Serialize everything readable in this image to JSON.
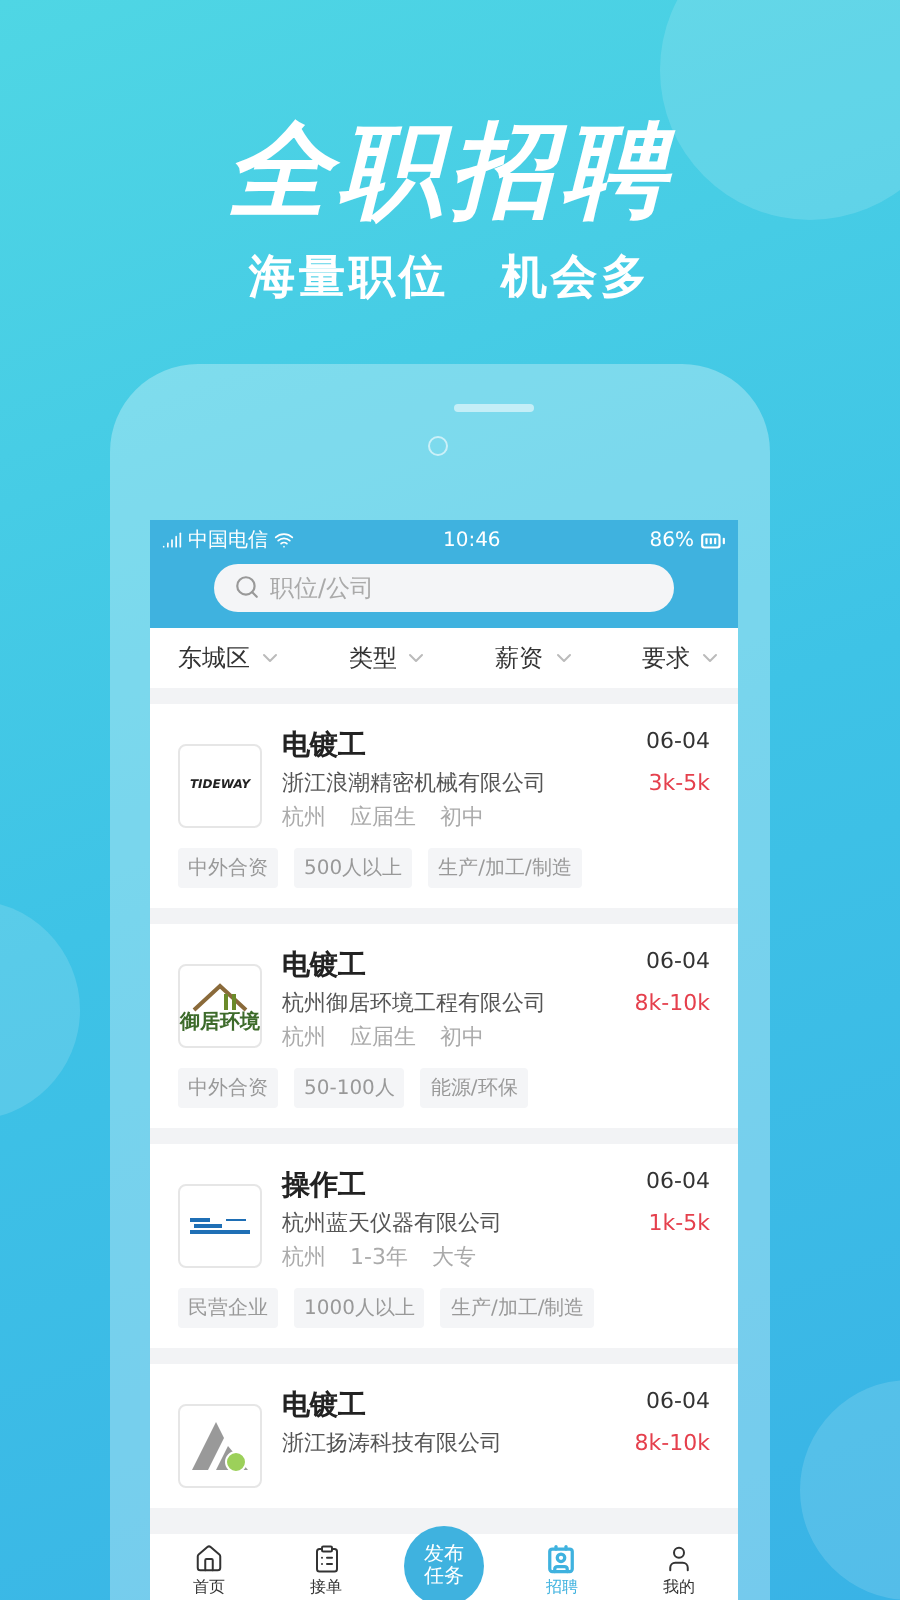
{
  "hero": {
    "title": "全职招聘",
    "subtitle": [
      "海量职位",
      "机会多"
    ]
  },
  "status_bar": {
    "carrier": "中国电信",
    "time": "10:46",
    "battery": "86%"
  },
  "search": {
    "placeholder": "职位/公司"
  },
  "filters": [
    {
      "label": "东城区"
    },
    {
      "label": "类型"
    },
    {
      "label": "薪资"
    },
    {
      "label": "要求"
    }
  ],
  "jobs": [
    {
      "title": "电镀工",
      "company": "浙江浪潮精密机械有限公司",
      "date": "06-04",
      "salary": "3k-5k",
      "meta": [
        "杭州",
        "应届生",
        "初中"
      ],
      "tags": [
        "中外合资",
        "500人以上",
        "生产/加工/制造"
      ],
      "logo": {
        "kind": "wordmark",
        "text": "TIDEWAY"
      }
    },
    {
      "title": "电镀工",
      "company": "杭州御居环境工程有限公司",
      "date": "06-04",
      "salary": "8k-10k",
      "meta": [
        "杭州",
        "应届生",
        "初中"
      ],
      "tags": [
        "中外合资",
        "50-100人",
        "能源/环保"
      ],
      "logo": {
        "kind": "house",
        "text": "御居环境"
      }
    },
    {
      "title": "操作工",
      "company": "杭州蓝天仪器有限公司",
      "date": "06-04",
      "salary": "1k-5k",
      "meta": [
        "杭州",
        "1-3年",
        "大专"
      ],
      "tags": [
        "民营企业",
        "1000人以上",
        "生产/加工/制造"
      ],
      "logo": {
        "kind": "stripe"
      }
    },
    {
      "title": "电镀工",
      "company": "浙江扬涛科技有限公司",
      "date": "06-04",
      "salary": "8k-10k",
      "logo": {
        "kind": "triangle"
      }
    }
  ],
  "tabs": [
    {
      "label": "首页",
      "kind": "home",
      "selected": false
    },
    {
      "label": "接单",
      "kind": "clipboard",
      "selected": false
    },
    {
      "label": "发布任务",
      "kind": "publish",
      "selected": false
    },
    {
      "label": "招聘",
      "kind": "card",
      "selected": true
    },
    {
      "label": "我的",
      "kind": "user",
      "selected": false
    }
  ]
}
